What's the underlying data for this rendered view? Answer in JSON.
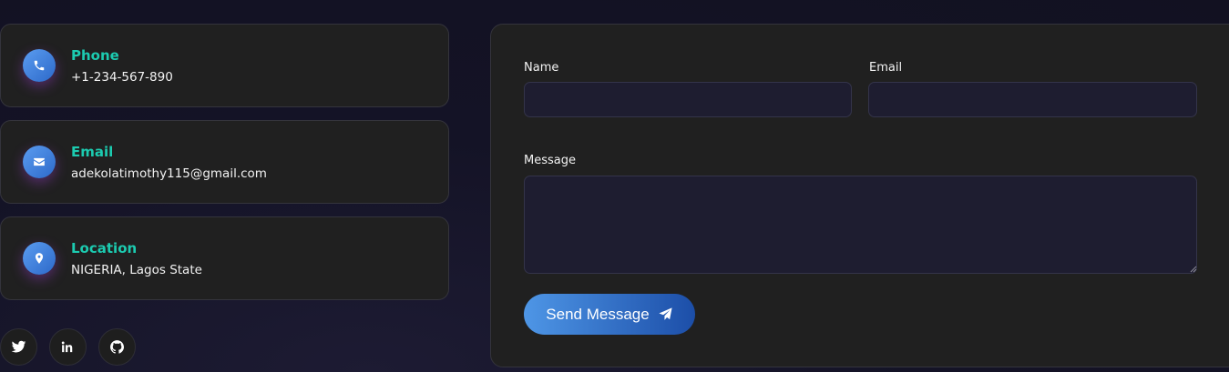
{
  "contact_cards": [
    {
      "title": "Phone",
      "value": "+1-234-567-890",
      "icon": "phone-icon"
    },
    {
      "title": "Email",
      "value": "adekolatimothy115@gmail.com",
      "icon": "envelope-icon"
    },
    {
      "title": "Location",
      "value": "NIGERIA, Lagos State",
      "icon": "map-pin-icon"
    }
  ],
  "socials": [
    {
      "name": "twitter",
      "icon": "twitter-icon"
    },
    {
      "name": "linkedin",
      "icon": "linkedin-icon"
    },
    {
      "name": "github",
      "icon": "github-icon"
    }
  ],
  "form": {
    "name_label": "Name",
    "name_value": "",
    "email_label": "Email",
    "email_value": "",
    "message_label": "Message",
    "message_value": "",
    "submit_label": "Send Message",
    "submit_icon": "paper-plane-icon"
  },
  "colors": {
    "accent_teal": "#1ccbb0",
    "button_gradient_start": "#4e96e6",
    "button_gradient_end": "#1c4ea8",
    "card_bg": "#202020",
    "field_bg": "#1e1d30"
  }
}
